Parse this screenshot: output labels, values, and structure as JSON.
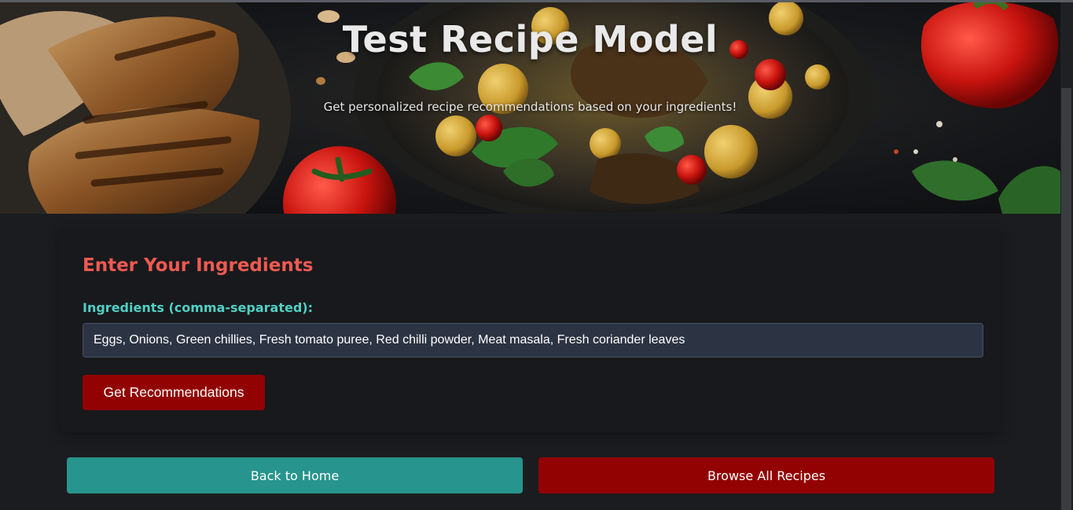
{
  "hero": {
    "title": "Test Recipe Model",
    "subtitle": "Get personalized recipe recommendations based on your ingredients!"
  },
  "form": {
    "heading": "Enter Your Ingredients",
    "ingredients_label": "Ingredients (comma-separated):",
    "ingredients_value": "Eggs, Onions, Green chillies, Fresh tomato puree, Red chilli powder, Meat masala, Fresh coriander leaves",
    "submit_label": "Get Recommendations"
  },
  "actions": {
    "back_label": "Back to Home",
    "browse_label": "Browse All Recipes"
  },
  "colors": {
    "background": "#1b1c1f",
    "card": "#18191c",
    "heading": "#ee5a52",
    "label": "#4fd1c5",
    "primary_red": "#920202",
    "teal": "#27948d",
    "input_bg": "#2c3443"
  }
}
